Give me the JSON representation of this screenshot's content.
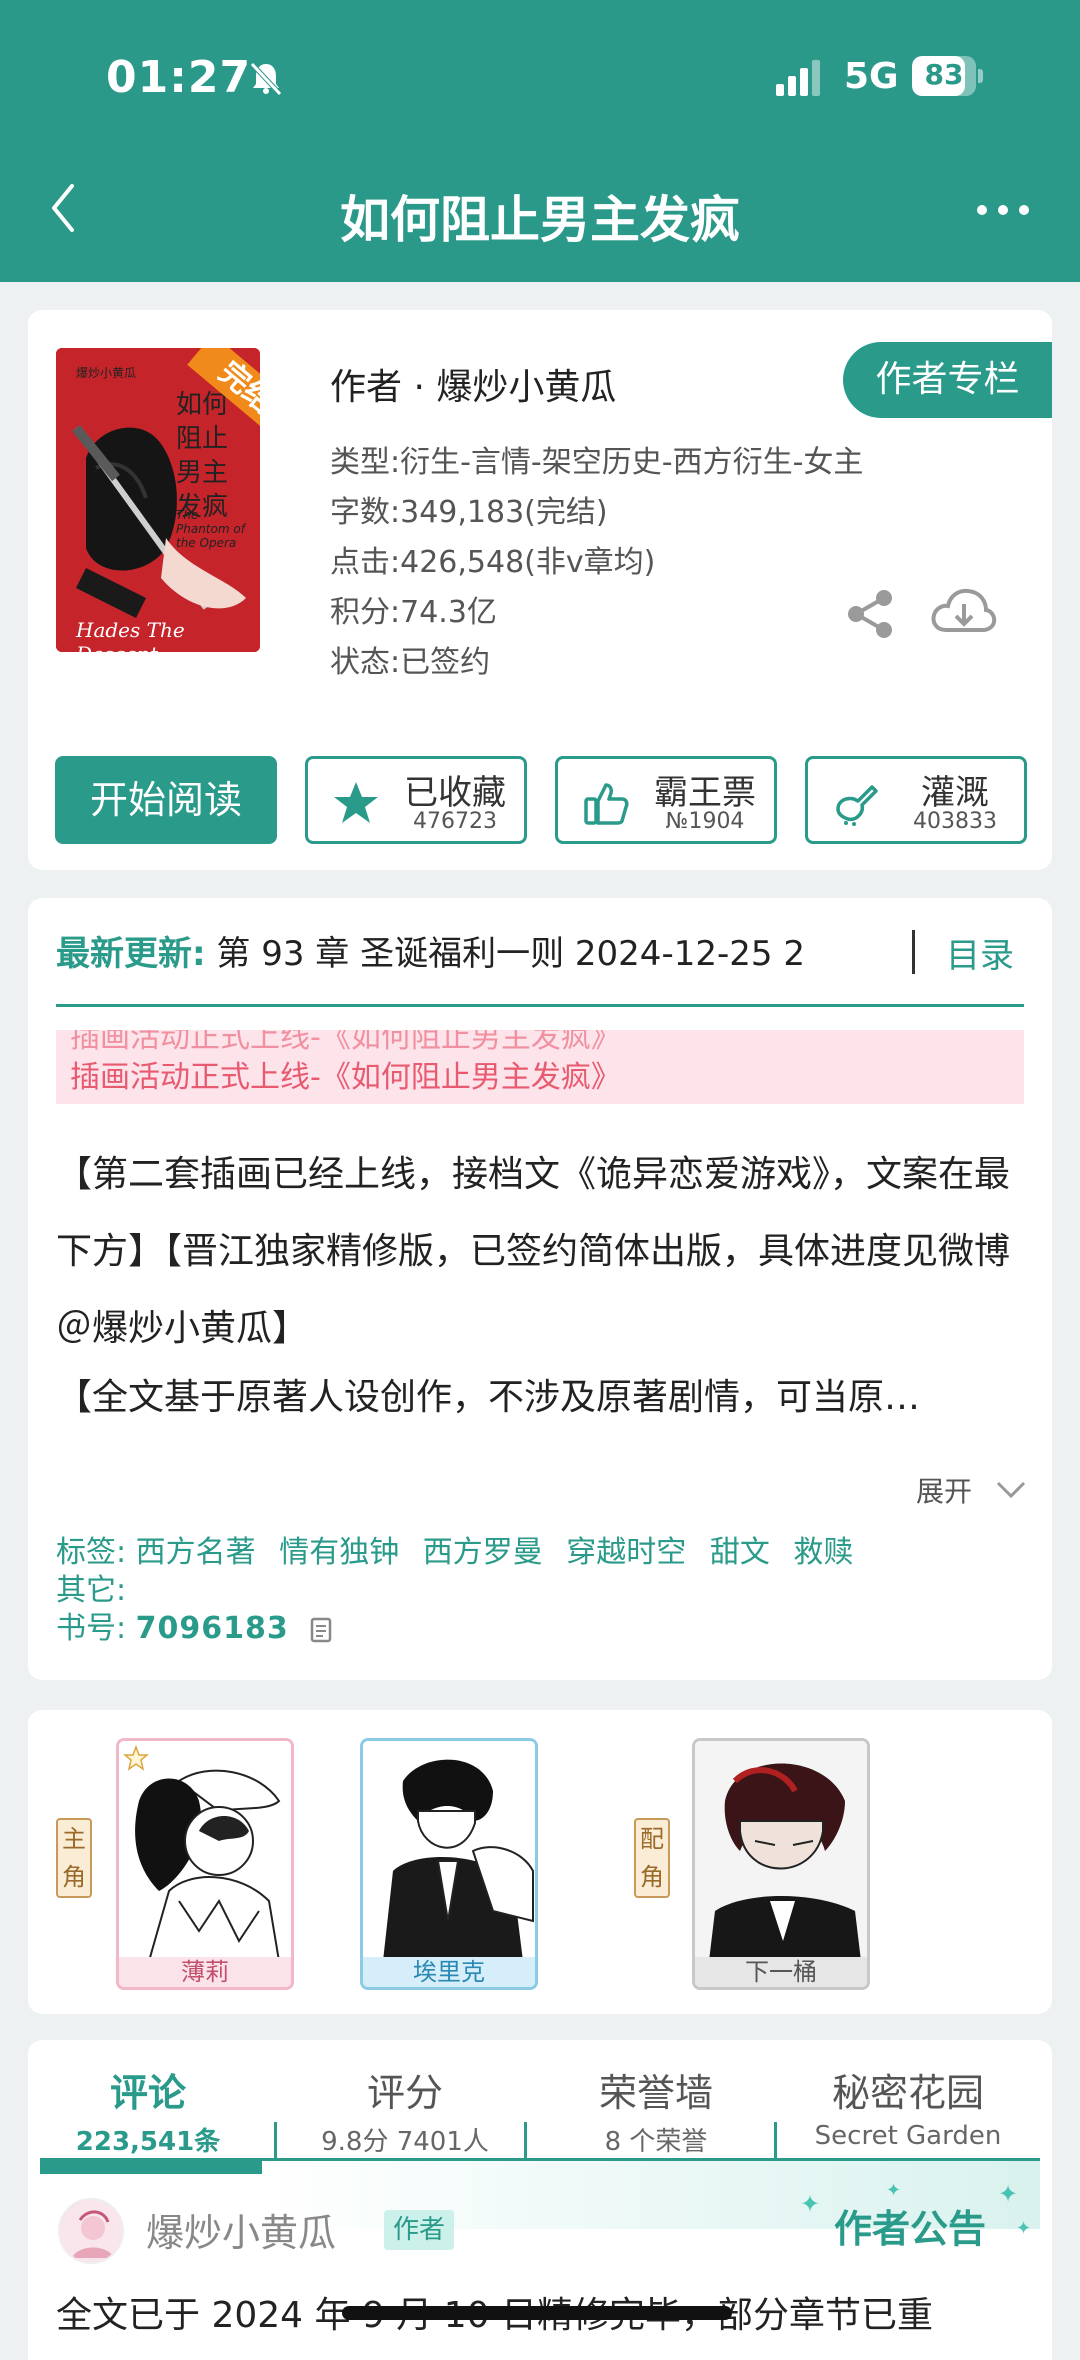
{
  "status_bar": {
    "time": "01:27",
    "network": "5G",
    "battery": "83",
    "battery_level": 0.83
  },
  "nav": {
    "title": "如何阻止男主发疯"
  },
  "book": {
    "cover": {
      "status_ribbon": "完结",
      "author_small": "爆炒小黄瓜",
      "title": "如何阻止男主发疯",
      "subtitle": "The Phantom of the Opera",
      "footer": "Hades The Descent"
    },
    "author_line": "作者 · 爆炒小黄瓜",
    "author_column_btn": "作者专栏",
    "meta": {
      "genre": "类型:衍生-言情-架空历史-西方衍生-女主",
      "words": "字数:349,183(完结)",
      "clicks": "点击:426,548(非v章均)",
      "score": "积分:74.3亿",
      "status": "状态:已签约"
    },
    "actions": {
      "start": "开始阅读",
      "collect": {
        "label": "已收藏",
        "count": "476723"
      },
      "ticket": {
        "label": "霸王票",
        "count": "№1904"
      },
      "water": {
        "label": "灌溉",
        "count": "403833"
      }
    }
  },
  "update": {
    "label": "最新更新:",
    "text": "第 93 章 圣诞福利一则 2024-12-25 2",
    "catalog": "目录"
  },
  "banner": {
    "ghost": "插画活动正式上线-《如何阻止男主发疯》",
    "text": "插画活动正式上线-《如何阻止男主发疯》"
  },
  "description": {
    "p1": "【第二套插画已经上线，接档文《诡异恋爱游戏》，文案在最下方】【晋江独家精修版，已签约简体出版，具体进度见微博＠爆炒小黄瓜】",
    "p2": "【全文基于原著人设创作，不涉及原著剧情，可当原…",
    "expand": "展开"
  },
  "tags": {
    "label": "标签:",
    "items": [
      "西方名著",
      "情有独钟",
      "西方罗曼",
      "穿越时空",
      "甜文",
      "救赎"
    ],
    "other_label": "其它:",
    "id_label": "书号:",
    "id_value": "7096183"
  },
  "characters": {
    "lead_tag": "主角",
    "support_tag": "配角",
    "items": [
      {
        "name": "薄莉",
        "border": "#f2b8c8",
        "bg": "#fbe3ea",
        "color": "#c2506c"
      },
      {
        "name": "埃里克",
        "border": "#8ccbe6",
        "bg": "#d6eef9",
        "color": "#2a88b4"
      },
      {
        "name": "下一桶",
        "border": "#c8c8c8",
        "bg": "#e6e6e6",
        "color": "#555555"
      }
    ]
  },
  "tabs": [
    {
      "title": "评论",
      "sub": "223,541条"
    },
    {
      "title": "评分",
      "sub": "9.8分 7401人"
    },
    {
      "title": "荣誉墙",
      "sub": "8 个荣誉"
    },
    {
      "title": "秘密花园",
      "sub": "Secret Garden"
    }
  ],
  "notice": {
    "poster": "爆炒小黄瓜",
    "badge": "作者",
    "title": "作者公告",
    "body": "全文已于 2024 年 9 月 10 日精修完毕，部分章节已重"
  },
  "colors": {
    "accent": "#2a9a8a",
    "header": "#2b998a",
    "banner_bg": "#fde3ea",
    "banner_text": "#e85a70"
  }
}
